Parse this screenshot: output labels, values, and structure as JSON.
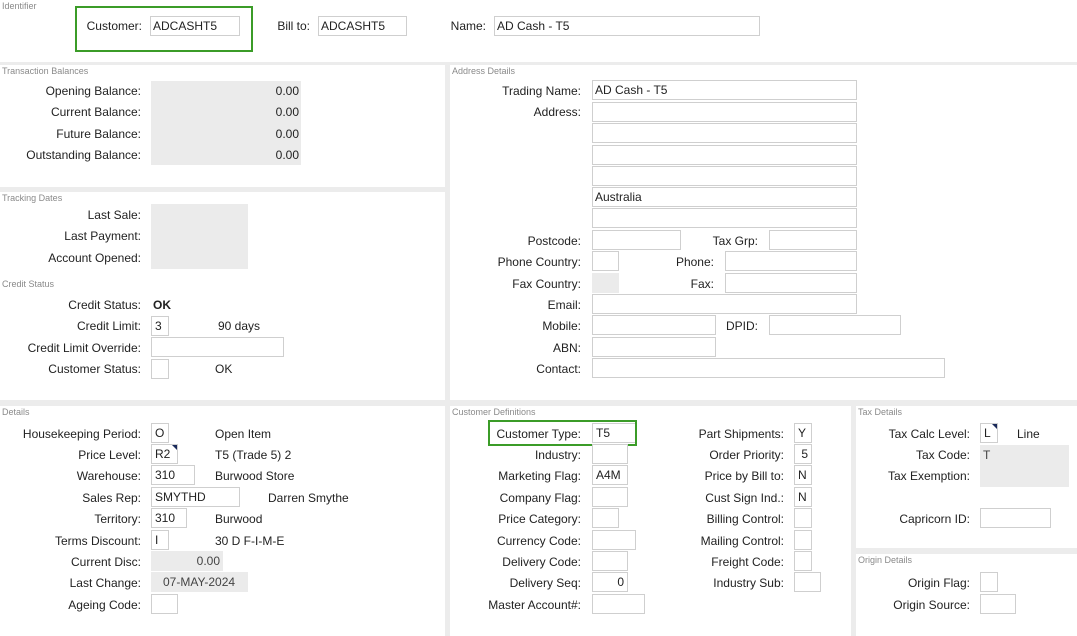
{
  "identifier": {
    "title": "Identifier",
    "customer_label": "Customer:",
    "customer_value": "ADCASHT5",
    "bill_to_label": "Bill to:",
    "bill_to_value": "ADCASHT5",
    "name_label": "Name:",
    "name_value": "AD Cash - T5"
  },
  "transaction_balances": {
    "title": "Transaction Balances",
    "rows": [
      {
        "label": "Opening Balance:",
        "value": "0.00"
      },
      {
        "label": "Current Balance:",
        "value": "0.00"
      },
      {
        "label": "Future Balance:",
        "value": "0.00"
      },
      {
        "label": "Outstanding Balance:",
        "value": "0.00"
      }
    ]
  },
  "tracking_dates": {
    "title": "Tracking Dates",
    "labels": [
      "Last Sale:",
      "Last Payment:",
      "Account Opened:"
    ]
  },
  "credit_status": {
    "title": "Credit Status",
    "status_label": "Credit Status:",
    "status_value": "OK",
    "limit_label": "Credit Limit:",
    "limit_value": "3",
    "limit_desc": "90 days",
    "override_label": "Credit Limit Override:",
    "override_value": "",
    "customer_status_label": "Customer Status:",
    "customer_status_value": "",
    "customer_status_desc": "OK"
  },
  "address_details": {
    "title": "Address Details",
    "trading_name_label": "Trading Name:",
    "trading_name_value": "AD Cash - T5",
    "address_label": "Address:",
    "address_lines": [
      "",
      "",
      "",
      "",
      "Australia",
      ""
    ],
    "postcode_label": "Postcode:",
    "postcode_value": "",
    "tax_grp_label": "Tax Grp:",
    "tax_grp_value": "",
    "phone_country_label": "Phone Country:",
    "phone_label": "Phone:",
    "fax_country_label": "Fax Country:",
    "fax_label": "Fax:",
    "email_label": "Email:",
    "mobile_label": "Mobile:",
    "dpid_label": "DPID:",
    "abn_label": "ABN:",
    "contact_label": "Contact:"
  },
  "details": {
    "title": "Details",
    "housekeeping_label": "Housekeeping Period:",
    "housekeeping_value": "O",
    "housekeeping_desc": "Open Item",
    "price_level_label": "Price Level:",
    "price_level_value": "R2",
    "price_level_desc": "T5 (Trade 5) 2",
    "warehouse_label": "Warehouse:",
    "warehouse_value": "310",
    "warehouse_desc": "Burwood Store",
    "sales_rep_label": "Sales Rep:",
    "sales_rep_value": "SMYTHD",
    "sales_rep_desc": "Darren Smythe",
    "territory_label": "Territory:",
    "territory_value": "310",
    "territory_desc": "Burwood",
    "terms_label": "Terms Discount:",
    "terms_value": "I",
    "terms_desc": "30 D F-I-M-E",
    "current_disc_label": "Current Disc:",
    "current_disc_value": "0.00",
    "last_change_label": "Last Change:",
    "last_change_value": "07-MAY-2024",
    "ageing_label": "Ageing Code:",
    "ageing_value": ""
  },
  "customer_definitions": {
    "title": "Customer Definitions",
    "customer_type_label": "Customer Type:",
    "customer_type_value": "T5",
    "industry_label": "Industry:",
    "marketing_flag_label": "Marketing Flag:",
    "marketing_flag_value": "A4M",
    "company_flag_label": "Company Flag:",
    "price_category_label": "Price Category:",
    "currency_code_label": "Currency Code:",
    "delivery_code_label": "Delivery Code:",
    "delivery_seq_label": "Delivery Seq:",
    "delivery_seq_value": "0",
    "master_account_label": "Master Account#:",
    "part_shipments_label": "Part Shipments:",
    "part_shipments_value": "Y",
    "order_priority_label": "Order Priority:",
    "order_priority_value": "5",
    "price_by_bill_label": "Price by Bill to:",
    "price_by_bill_value": "N",
    "cust_sign_label": "Cust Sign Ind.:",
    "cust_sign_value": "N",
    "billing_control_label": "Billing Control:",
    "mailing_control_label": "Mailing Control:",
    "freight_code_label": "Freight Code:",
    "industry_sub_label": "Industry Sub:"
  },
  "tax_details": {
    "title": "Tax Details",
    "calc_level_label": "Tax Calc Level:",
    "calc_level_value": "L",
    "calc_level_desc": "Line",
    "tax_code_label": "Tax Code:",
    "tax_code_value": "T",
    "tax_exemption_label": "Tax Exemption:",
    "capricorn_label": "Capricorn ID:"
  },
  "origin_details": {
    "title": "Origin Details",
    "origin_flag_label": "Origin Flag:",
    "origin_source_label": "Origin Source:"
  }
}
